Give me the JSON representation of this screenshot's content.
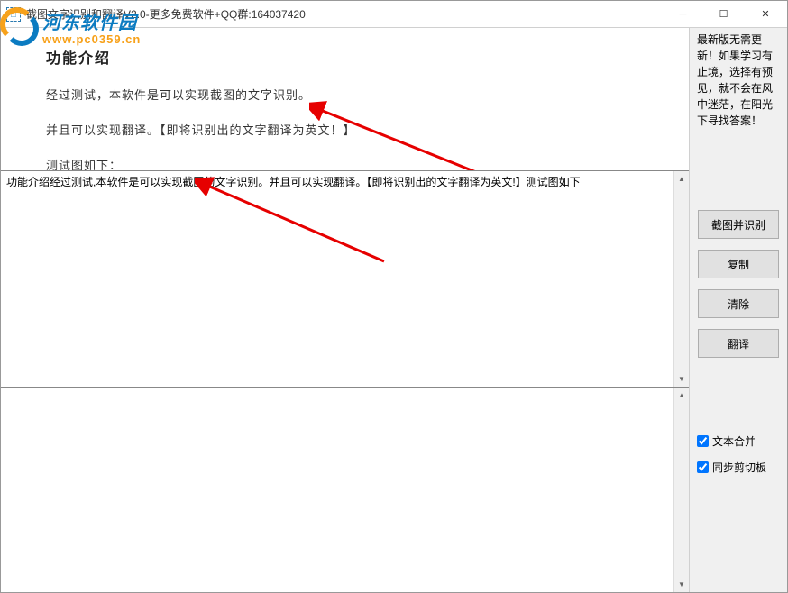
{
  "window": {
    "title": "截图文字识别和翻译V2.0-更多免费软件+QQ群:164037420"
  },
  "preview": {
    "heading": "功能介绍",
    "line1": "经过测试，本软件是可以实现截图的文字识别。",
    "line2": "并且可以实现翻译。【即将识别出的文字翻译为英文！】",
    "line3": "测试图如下："
  },
  "result_text": "功能介绍经过测试,本软件是可以实现截图的文字识别。并且可以实现翻译。【即将识别出的文字翻译为英文!】测试图如下",
  "info_text": "最新版无需更新！如果学习有止境，选择有预见，就不会在风中迷茫，在阳光下寻找答案！",
  "buttons": {
    "capture": "截图并识别",
    "copy": "复制",
    "clear": "清除",
    "translate": "翻译"
  },
  "checkboxes": {
    "merge": "文本合并",
    "clipboard": "同步剪切板"
  },
  "watermark": {
    "text": "河东软件园",
    "url": "www.pc0359.cn"
  }
}
